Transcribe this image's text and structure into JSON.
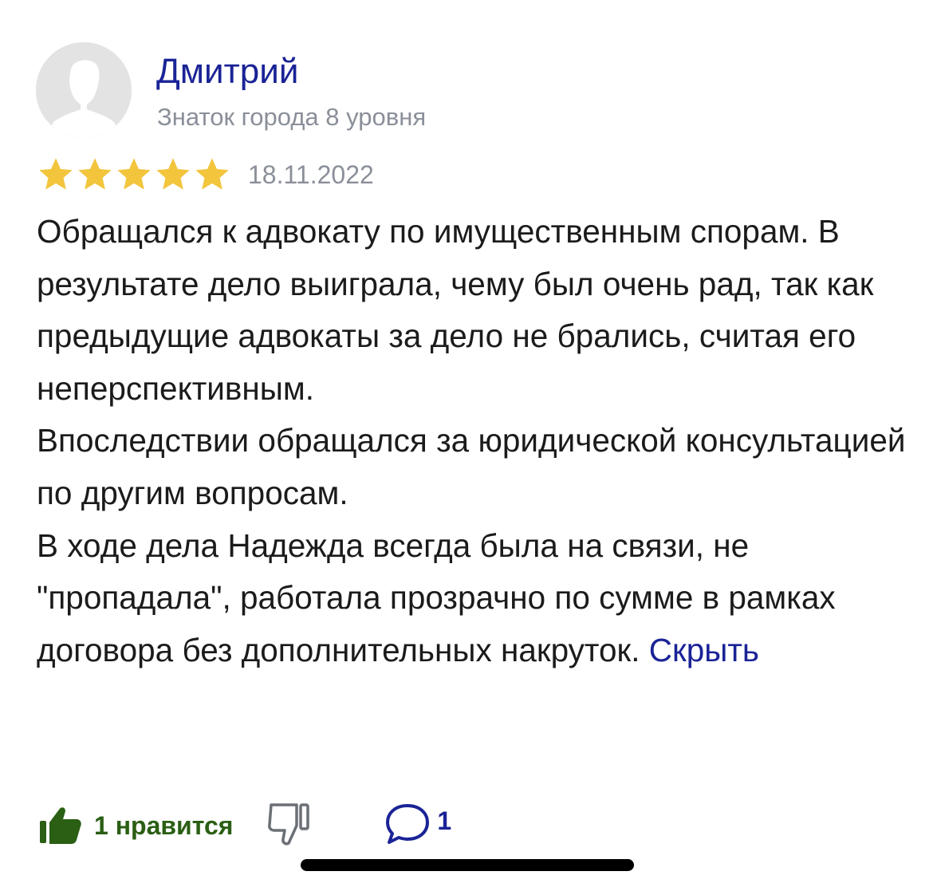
{
  "author": {
    "name": "Дмитрий",
    "level": "Знаток города 8 уровня",
    "avatar_icon": "person-silhouette-icon"
  },
  "review": {
    "rating": 5,
    "max_rating": 5,
    "star_color": "#f2c53d",
    "date": "18.11.2022",
    "paragraphs": [
      "Обращался к адвокату по имущественным спорам. В результате дело выиграла, чему был очень рад, так как предыдущие адвокаты за дело не брались, считая его неперспективным.",
      "Впоследствии обращался за юридической консультацией по другим вопросам.",
      "В ходе дела Надежда всегда была на связи, не \"пропадала\", работала прозрачно по сумме в рамках договора без дополнительных накруток."
    ],
    "collapse_label": "Скрыть"
  },
  "actions": {
    "like_label": "1 нравится",
    "like_icon": "thumbs-up-icon",
    "dislike_icon": "thumbs-down-icon",
    "comment_icon": "comment-bubble-icon",
    "comment_count": "1"
  },
  "colors": {
    "link": "#1a2396",
    "muted": "#8a8f99",
    "text": "#1b1b1b",
    "like_green": "#2a5f14"
  }
}
